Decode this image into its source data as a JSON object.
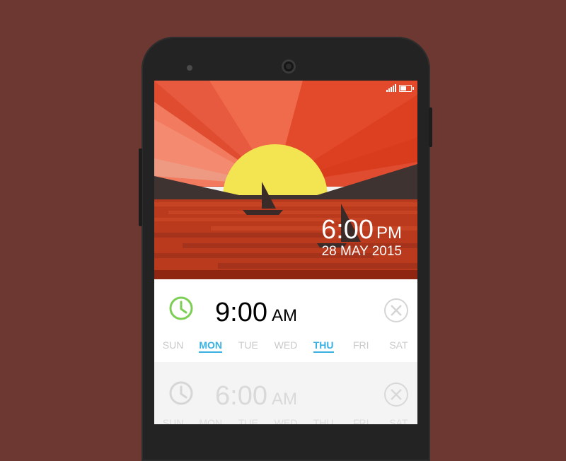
{
  "colors": {
    "background": "#6e3832",
    "accent_blue": "#3ab0e2",
    "clock_green": "#7ccf54",
    "sun": "#f3e451",
    "sea": "#b93a1d"
  },
  "status": {
    "battery_level": 0.6,
    "signal": "signal-icon"
  },
  "hero": {
    "time": "6:00",
    "ampm": "PM",
    "date": "28 MAY 2015"
  },
  "alarms": [
    {
      "time": "9:00",
      "ampm": "AM",
      "enabled": true,
      "days": [
        {
          "label": "SUN",
          "active": false
        },
        {
          "label": "MON",
          "active": true
        },
        {
          "label": "TUE",
          "active": false
        },
        {
          "label": "WED",
          "active": false
        },
        {
          "label": "THU",
          "active": true
        },
        {
          "label": "FRI",
          "active": false
        },
        {
          "label": "SAT",
          "active": false
        }
      ]
    },
    {
      "time": "6:00",
      "ampm": "AM",
      "enabled": false,
      "days": [
        {
          "label": "SUN",
          "active": false
        },
        {
          "label": "MON",
          "active": false
        },
        {
          "label": "TUE",
          "active": false
        },
        {
          "label": "WED",
          "active": false
        },
        {
          "label": "THU",
          "active": false
        },
        {
          "label": "FRI",
          "active": false
        },
        {
          "label": "SAT",
          "active": false
        }
      ]
    }
  ]
}
